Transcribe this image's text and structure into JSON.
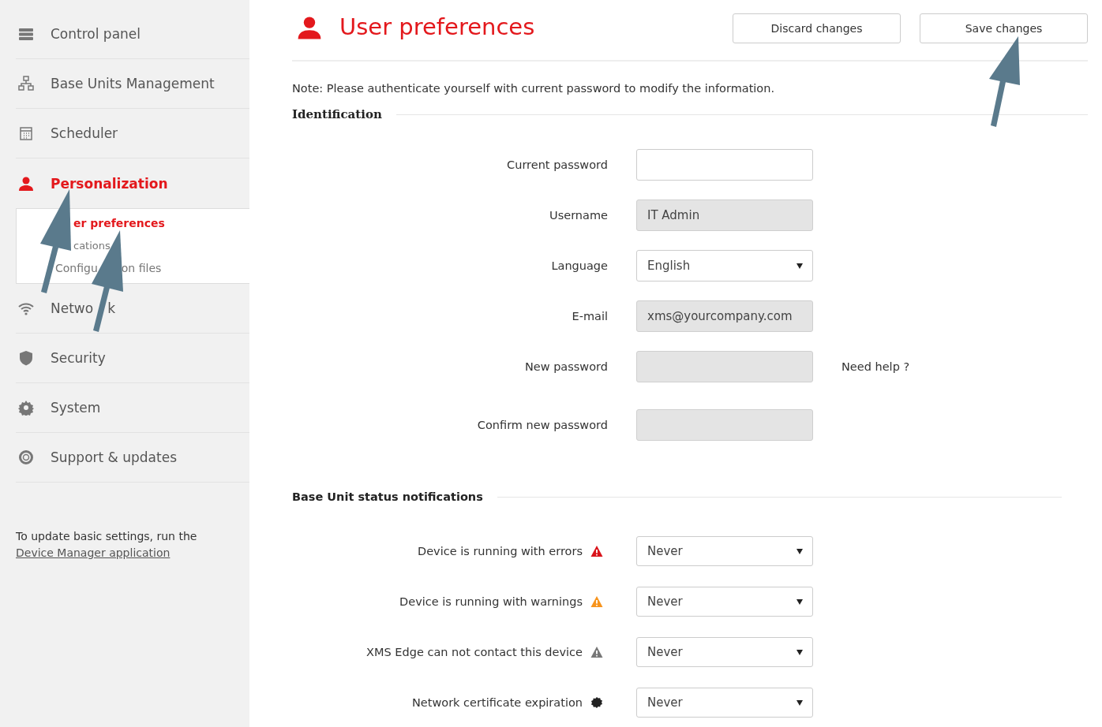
{
  "sidebar": {
    "items": [
      {
        "parts": [
          "Control panel"
        ],
        "selected": false
      },
      {
        "parts": [
          "Base Units Management"
        ],
        "selected": false
      },
      {
        "parts": [
          "Scheduler"
        ],
        "selected": false
      },
      {
        "parts": [
          "Personalization"
        ],
        "selected": true,
        "children": [
          {
            "parts": [
              "er preferences"
            ],
            "selected": true
          },
          {
            "parts": [
              "cations"
            ],
            "selected": false
          },
          {
            "parts": [
              "Configu",
              "on files"
            ],
            "selected": false
          }
        ]
      },
      {
        "parts": [
          "Netwo",
          "k"
        ],
        "selected": false
      },
      {
        "parts": [
          "Security"
        ],
        "selected": false
      },
      {
        "parts": [
          "System"
        ],
        "selected": false
      },
      {
        "parts": [
          "Support & updates"
        ],
        "selected": false
      }
    ],
    "footer": {
      "text": "To update basic settings, run the",
      "link": "Device Manager application"
    }
  },
  "header": {
    "title": "User preferences",
    "buttons": [
      "Discard changes",
      "Save changes"
    ]
  },
  "note": "Note: Please authenticate yourself with current password to modify the information.",
  "identification": {
    "heading": "Identification",
    "fields": [
      {
        "kind": "text",
        "label": "Current password",
        "disabled": false
      },
      {
        "kind": "text",
        "label": "Username",
        "value": "IT Admin",
        "disabled": true
      },
      {
        "kind": "select",
        "label": "Language",
        "value": "English",
        "disabled": false
      },
      {
        "kind": "text",
        "label": "E-mail",
        "value": "xms@yourcompany.com",
        "disabled": true
      },
      {
        "kind": "text",
        "label": "New password",
        "disabled": true,
        "aside": "Need help ?"
      },
      {
        "kind": "text",
        "label": "Confirm new password",
        "disabled": true
      }
    ]
  },
  "notifications": {
    "heading": "Base Unit status notifications",
    "rows": [
      {
        "label": "Device is running with errors",
        "kind": "error",
        "value": "Never"
      },
      {
        "label": "Device is running with warnings",
        "kind": "warning",
        "value": "Never"
      },
      {
        "label": "XMS Edge can not contact this device",
        "kind": "offline",
        "value": "Never"
      },
      {
        "label": "Network certificate expiration",
        "kind": "certificate",
        "value": "Never"
      }
    ]
  }
}
